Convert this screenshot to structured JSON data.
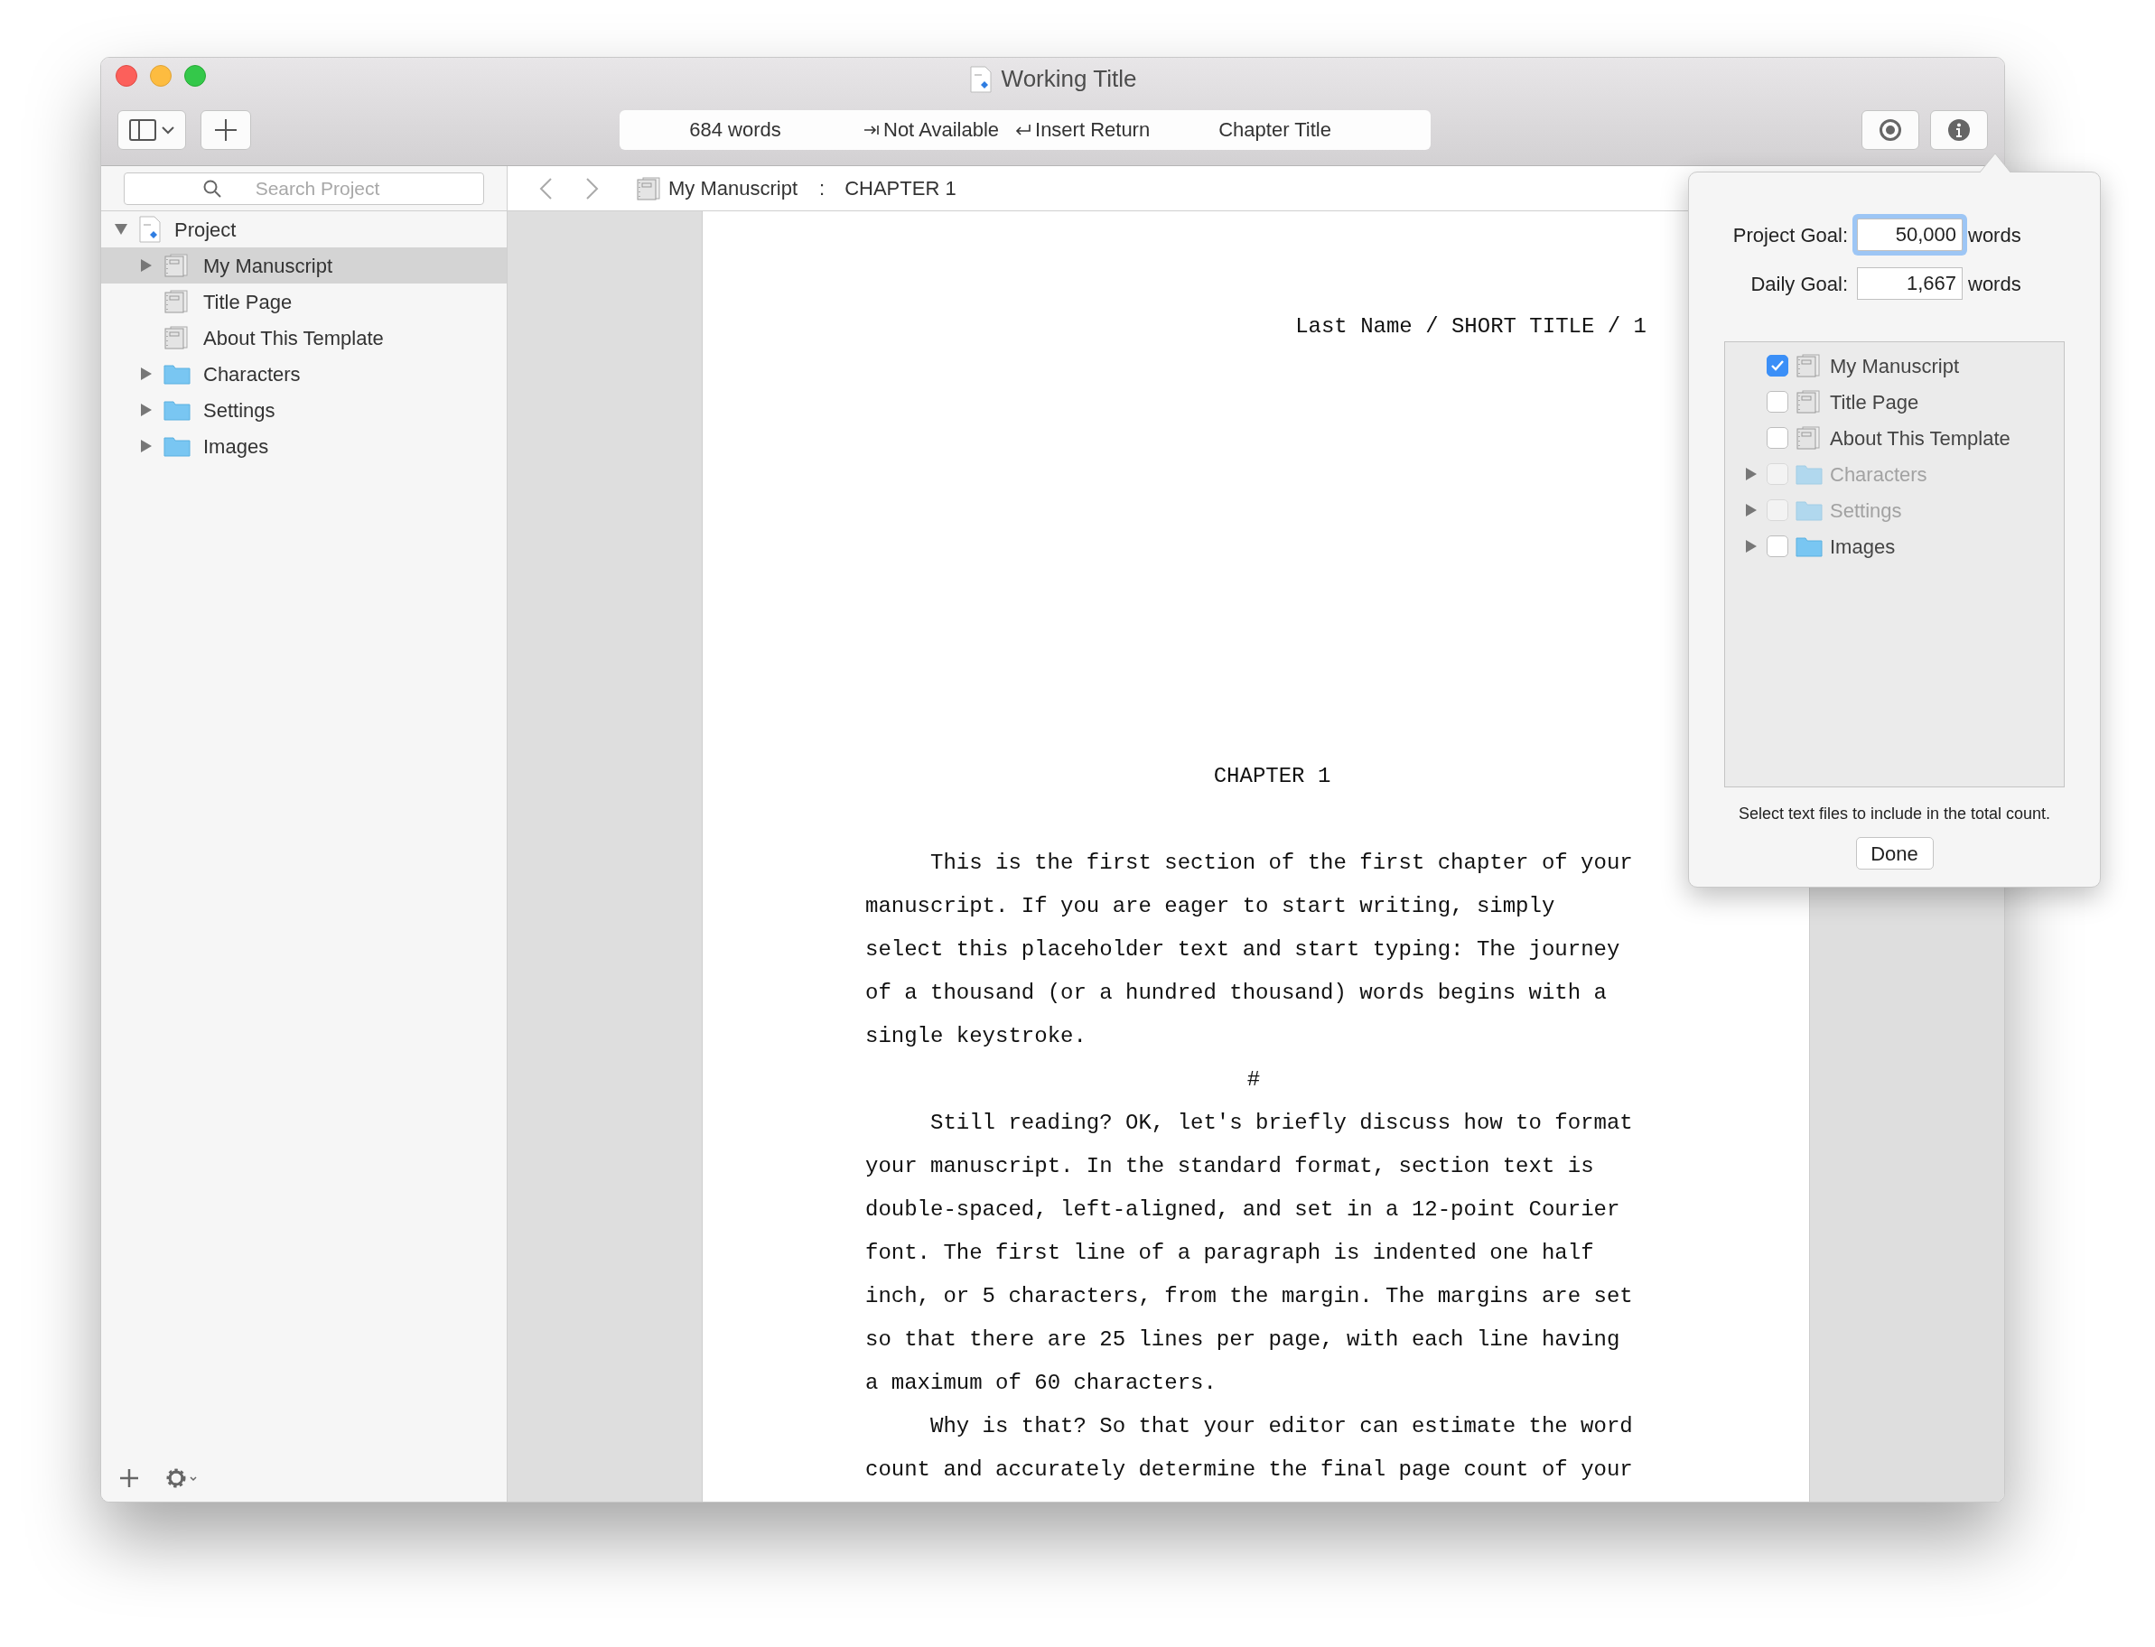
{
  "window": {
    "title": "Working Title"
  },
  "toolbar": {
    "word_count": "684 words",
    "tab_action": "Not Available",
    "return_action": "Insert Return",
    "section_type": "Chapter Title"
  },
  "sidebar": {
    "search": {
      "placeholder": "Search Project"
    },
    "tree": [
      {
        "label": "Project",
        "kind": "project",
        "expanded": true,
        "selected": false,
        "children": [
          {
            "label": "My Manuscript",
            "kind": "document",
            "expanded": false,
            "selected": true
          },
          {
            "label": "Title Page",
            "kind": "document",
            "selected": false
          },
          {
            "label": "About This Template",
            "kind": "document",
            "selected": false
          },
          {
            "label": "Characters",
            "kind": "folder",
            "expanded": false,
            "selected": false
          },
          {
            "label": "Settings",
            "kind": "folder",
            "expanded": false,
            "selected": false
          },
          {
            "label": "Images",
            "kind": "folder",
            "expanded": false,
            "selected": false
          }
        ]
      }
    ]
  },
  "breadcrumb": {
    "document": "My Manuscript",
    "separator": ":",
    "section": "CHAPTER 1"
  },
  "document": {
    "header": "Last Name / SHORT TITLE / 1",
    "chapter": "CHAPTER 1",
    "blocks": [
      {
        "kind": "paragraph",
        "text": "This is the first section of the first chapter of your manuscript. If you are eager to start writing, simply select this placeholder text and start typing: The journey of a thousand (or a hundred thousand) words begins with a single keystroke."
      },
      {
        "kind": "scene_break",
        "text": "#"
      },
      {
        "kind": "paragraph",
        "text": "Still reading? OK, let's briefly discuss how to format your manuscript. In the standard format, section text is double-spaced, left-aligned, and set in a 12-point Courier font. The first line of a paragraph is indented one half inch, or 5 characters, from the margin. The margins are set so that there are 25 lines per page, with each line having a maximum of 60 characters."
      },
      {
        "kind": "paragraph",
        "text": "Why is that? So that your editor can estimate the word count and accurately determine the final page count of your"
      }
    ]
  },
  "goals_popover": {
    "fields": [
      {
        "label": "Project Goal:",
        "value": "50,000",
        "unit": "words",
        "focused": true
      },
      {
        "label": "Daily Goal:",
        "value": "1,667",
        "unit": "words",
        "focused": false
      }
    ],
    "items": [
      {
        "label": "My Manuscript",
        "kind": "document",
        "checked": true,
        "disabled": false
      },
      {
        "label": "Title Page",
        "kind": "document",
        "checked": false,
        "disabled": false
      },
      {
        "label": "About This Template",
        "kind": "document",
        "checked": false,
        "disabled": false
      },
      {
        "label": "Characters",
        "kind": "folder",
        "expanded": false,
        "checked": false,
        "disabled": true
      },
      {
        "label": "Settings",
        "kind": "folder",
        "expanded": false,
        "checked": false,
        "disabled": true
      },
      {
        "label": "Images",
        "kind": "folder",
        "expanded": false,
        "checked": false,
        "disabled": false
      }
    ],
    "caption": "Select text files to include in the total count.",
    "done": "Done"
  }
}
